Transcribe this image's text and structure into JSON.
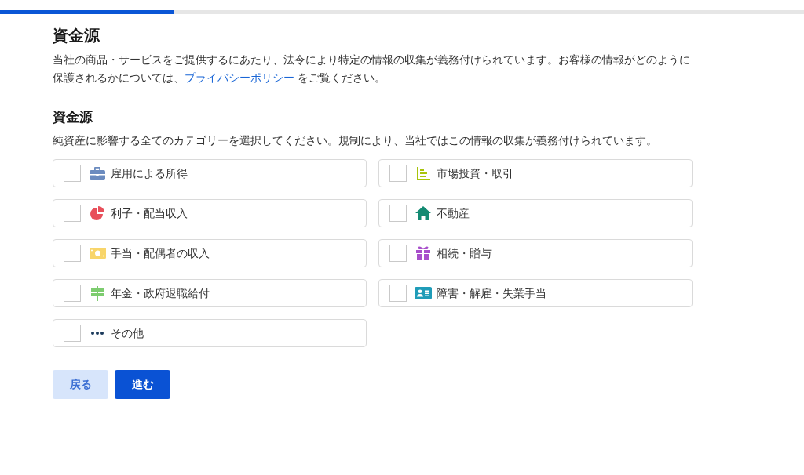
{
  "progress": {
    "level": 0.216
  },
  "page": {
    "title": "資金源",
    "intro": {
      "text": "当社の商品・サービスをご提供するにあたり、法令により特定の情報の収集が義務付けられています。お客様の情報がどのように保護されるかについては、",
      "link": "プライバシーポリシー",
      "text_after": " をご覧ください。"
    }
  },
  "section": {
    "title": "資金源",
    "description": "純資産に影響する全てのカテゴリーを選択してください。規制により、当社ではこの情報の収集が義務付けられています。",
    "options": [
      {
        "label": "雇用による所得",
        "checked": false
      },
      {
        "label": "市場投資・取引",
        "checked": false
      },
      {
        "label": "利子・配当収入",
        "checked": false
      },
      {
        "label": "不動産",
        "checked": false
      },
      {
        "label": "手当・配偶者の収入",
        "checked": false
      },
      {
        "label": "相続・贈与",
        "checked": false
      },
      {
        "label": "年金・政府退職給付",
        "checked": false
      },
      {
        "label": "障害・解雇・失業手当",
        "checked": false
      },
      {
        "label": "その他",
        "checked": false
      }
    ]
  },
  "buttons": [
    {
      "label": "戻る",
      "kind": "secondary"
    },
    {
      "label": "進む",
      "kind": "primary"
    }
  ]
}
